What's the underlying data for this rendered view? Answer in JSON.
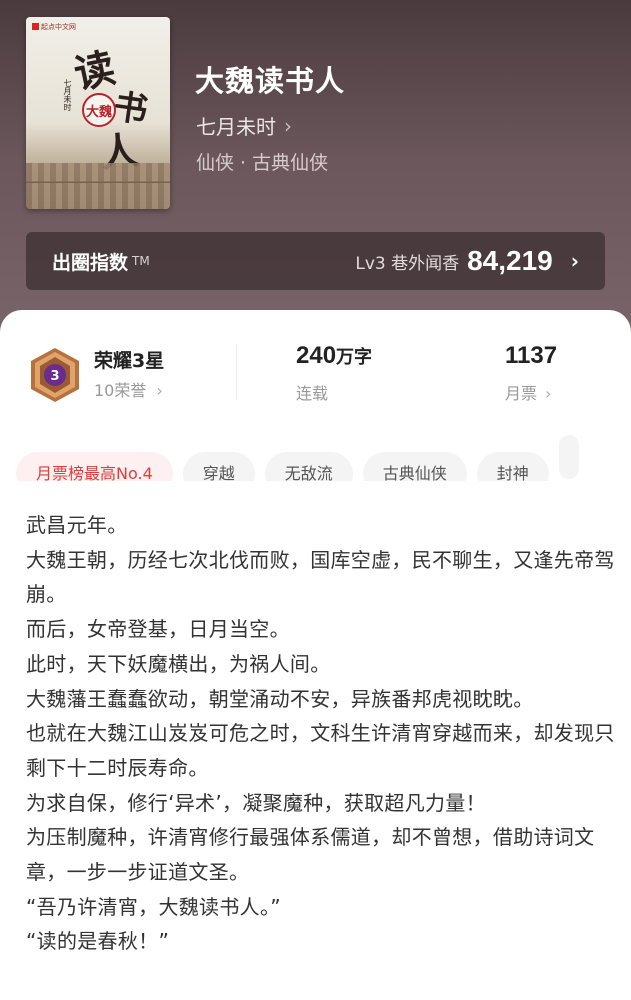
{
  "book": {
    "title": "大魏读书人",
    "author": "七月未时",
    "genre": "仙侠 · 古典仙侠",
    "cover": {
      "publisher_mark": "起点中文网",
      "title_big_1": "读",
      "title_big_2": "书",
      "title_big_3": "人",
      "seal_text": "大魏",
      "author_vertical": "七月未时"
    }
  },
  "index": {
    "label": "出圈指数",
    "tm": "TM",
    "level": "Lv3 巷外闻香",
    "value": "84,219"
  },
  "stats": {
    "honor_title": "荣耀3星",
    "honor_sub": "10荣誉",
    "medal_number": "3",
    "words_value": "240",
    "words_unit": "万字",
    "words_sub": "连载",
    "ticket_value": "1137",
    "ticket_sub": "月票"
  },
  "tags": [
    "月票榜最高No.4",
    "穿越",
    "无敌流",
    "古典仙侠",
    "封神"
  ],
  "synopsis": [
    "武昌元年。",
    "大魏王朝，历经七次北伐而败，国库空虚，民不聊生，又逢先帝驾崩。",
    "而后，女帝登基，日月当空。",
    "此时，天下妖魔横出，为祸人间。",
    "大魏藩王蠢蠢欲动，朝堂涌动不安，异族番邦虎视眈眈。",
    "也就在大魏江山岌岌可危之时，文科生许清宵穿越而来，却发现只剩下十二时辰寿命。",
    "为求自保，修行‘异术’，凝聚魔种，获取超凡力量！",
    "为压制魔种，许清宵修行最强体系儒道，却不曾想，借助诗词文章，一步一步证道文圣。",
    "“吾乃许清宵，大魏读书人。”",
    "“读的是春秋！”"
  ],
  "colors": {
    "header_bg": "#6b575c",
    "hot_tag": "#e03c3c",
    "medal_purple": "#6a2c8e"
  }
}
